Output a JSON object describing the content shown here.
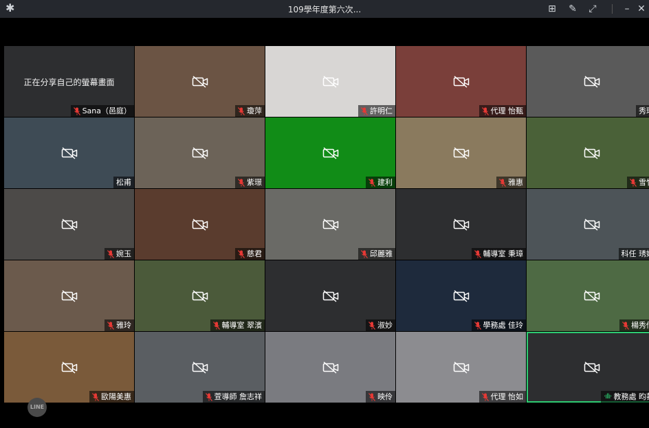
{
  "window": {
    "title": "109學年度第六次...",
    "icons": {
      "settings": "gear-icon",
      "layout": "grid-layout-icon",
      "pin": "pin-icon",
      "fullscreen": "fullscreen-icon",
      "minimize": "minimize-icon",
      "close": "close-icon"
    },
    "glyphs": {
      "settings": "✱",
      "layout": "⊞",
      "pin": "✎",
      "fullscreen": "⤢",
      "minimize": "–",
      "close": "✕"
    }
  },
  "share_tile_text": "正在分享自己的螢幕畫面",
  "colors": {
    "active_speaker": "#2ecc71",
    "mic_muted": "#e53935"
  },
  "tiles": [
    {
      "name": "Sana（邑庭）",
      "bg": "#2d2e30",
      "screen_share": true,
      "muted": true
    },
    {
      "name": "瓊萍",
      "bg": "#6b5444",
      "muted": true
    },
    {
      "name": "許明仁",
      "bg": "#d8d6d4",
      "muted": true
    },
    {
      "name": "代理 怡甄",
      "bg": "#7a3f3a",
      "muted": true
    },
    {
      "name": "秀玲",
      "bg": "#5a5a5a",
      "muted": false
    },
    {
      "name": "松甫",
      "bg": "#3e4b55",
      "muted": false
    },
    {
      "name": "紫璟",
      "bg": "#6c6358",
      "muted": true
    },
    {
      "name": "建利",
      "bg": "#118c17",
      "muted": true
    },
    {
      "name": "雅惠",
      "bg": "#8a7a5e",
      "muted": true
    },
    {
      "name": "雪竹",
      "bg": "#4a6138",
      "muted": true
    },
    {
      "name": "婉玉",
      "bg": "#4c4a48",
      "muted": true
    },
    {
      "name": "慈君",
      "bg": "#5a3c2e",
      "muted": true
    },
    {
      "name": "邱麗雅",
      "bg": "#6a6a66",
      "muted": true
    },
    {
      "name": "輔導室 秉璋",
      "bg": "#2d2e30",
      "muted": true
    },
    {
      "name": "科任 琇婷",
      "bg": "#4d5458",
      "muted": false
    },
    {
      "name": "雅玲",
      "bg": "#6b5a4c",
      "muted": true
    },
    {
      "name": "輔導室 翠濱",
      "bg": "#4b5a3a",
      "muted": true
    },
    {
      "name": "淑妙",
      "bg": "#2d2e30",
      "muted": true
    },
    {
      "name": "學務處 佳玲",
      "bg": "#1e2a3c",
      "muted": true
    },
    {
      "name": "楊秀倩",
      "bg": "#4e6a44",
      "muted": true
    },
    {
      "name": "歐陽美惠",
      "bg": "#7a5a3a",
      "muted": true
    },
    {
      "name": "萱導師 詹志祥",
      "bg": "#5a5e62",
      "muted": true
    },
    {
      "name": "映伶",
      "bg": "#7a7b80",
      "muted": true
    },
    {
      "name": "代理 怡如",
      "bg": "#8c8c90",
      "muted": true
    },
    {
      "name": "教務處 昀蓁",
      "bg": "#2d2e30",
      "muted": false,
      "speaking": true
    }
  ],
  "line_logo": "LINE"
}
